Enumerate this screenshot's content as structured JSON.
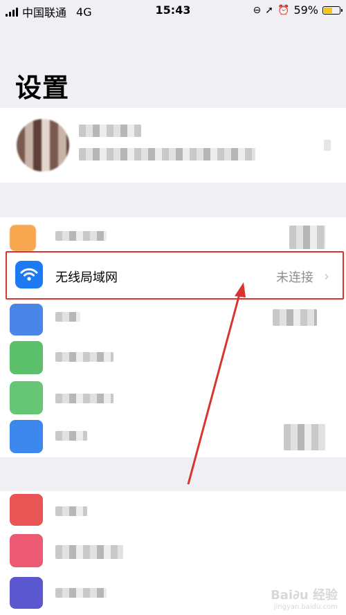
{
  "status_bar": {
    "carrier": "中国联通",
    "network": "4G",
    "time": "15:43",
    "battery_percent": "59%",
    "battery_level": 0.59
  },
  "page": {
    "title": "设置"
  },
  "wifi_row": {
    "label": "无线局域网",
    "status": "未连接",
    "chevron": "›",
    "icon": "wifi-icon",
    "icon_color": "#1c7bf2"
  },
  "annotation": {
    "box_color": "#d9342f",
    "arrow_color": "#d9342f"
  },
  "watermark": {
    "text": "Bai∂u 经验",
    "sub": "jingyan.baidu.com"
  },
  "pixelated_rows_icon_colors": [
    "#f6a64e",
    "#4a86e8",
    "#5cbf6a",
    "#66c676",
    "#3d88ee",
    "#e95555",
    "#ec5a74",
    "#5b58cf"
  ]
}
